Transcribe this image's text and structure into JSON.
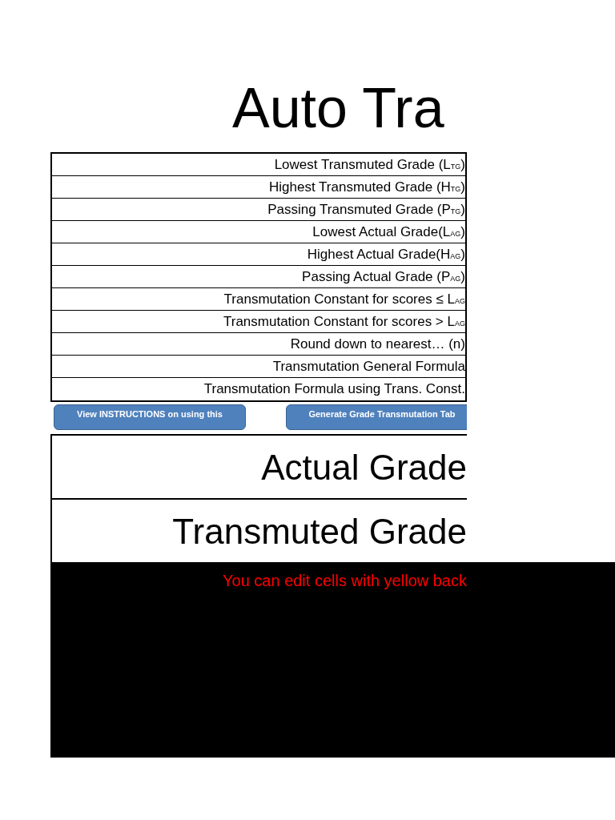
{
  "title": "Auto Tra",
  "parameters": [
    {
      "label": "Lowest Transmuted Grade (L$_{TG}$)"
    },
    {
      "label": "Highest Transmuted Grade (H$_{TG}$)"
    },
    {
      "label": "Passing Transmuted Grade (P$_{TG}$)"
    },
    {
      "label": "Lowest Actual Grade(L$_{AG}$)"
    },
    {
      "label": "Highest Actual Grade(H$_{AG}$)"
    },
    {
      "label": "Passing Actual Grade (P$_{AG}$)"
    },
    {
      "label": "Transmutation Constant for scores ≤ L$_{AG}$"
    },
    {
      "label": "Transmutation Constant for scores > L$_{AG}$"
    },
    {
      "label": "Round down to nearest… (n)"
    },
    {
      "label": "Transmutation General Formula"
    },
    {
      "label": "Transmutation Formula using Trans. Const."
    }
  ],
  "buttons": [
    "View INSTRUCTIONS on using this",
    "Generate Grade Transmutation Tab"
  ],
  "converter": [
    {
      "label": "Actual Grade"
    },
    {
      "label": "Transmuted Grade"
    }
  ],
  "note": "You can edit cells with yellow back"
}
